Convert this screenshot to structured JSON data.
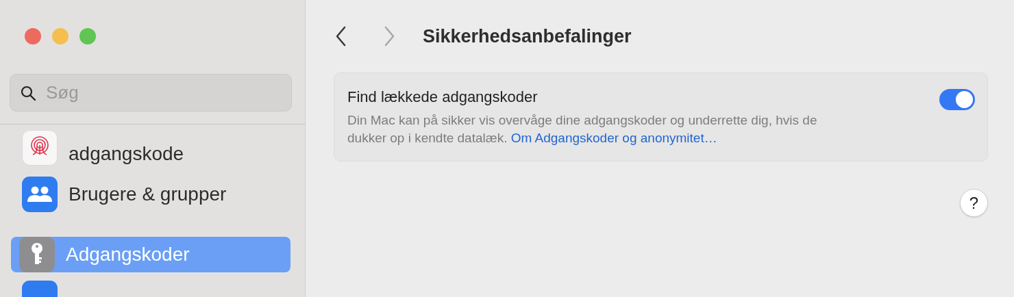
{
  "toolbar": {
    "title": "Sikkerhedsanbefalinger",
    "back_enabled": true,
    "forward_enabled": false
  },
  "search": {
    "placeholder": "Søg"
  },
  "sidebar": {
    "items": [
      {
        "label": "adgangskode",
        "kind": "fingerprint",
        "selected": false
      },
      {
        "label": "Brugere & grupper",
        "kind": "users",
        "selected": false
      },
      {
        "label": "Adgangskoder",
        "kind": "key",
        "selected": true
      }
    ]
  },
  "setting": {
    "title": "Find lækkede adgangskoder",
    "description": "Din Mac kan på sikker vis overvåge dine adgangskoder og underrette dig, hvis de dukker op i kendte datalæk.",
    "link": "Om Adgangskoder og anonymitet…",
    "on": true
  },
  "help": "?"
}
